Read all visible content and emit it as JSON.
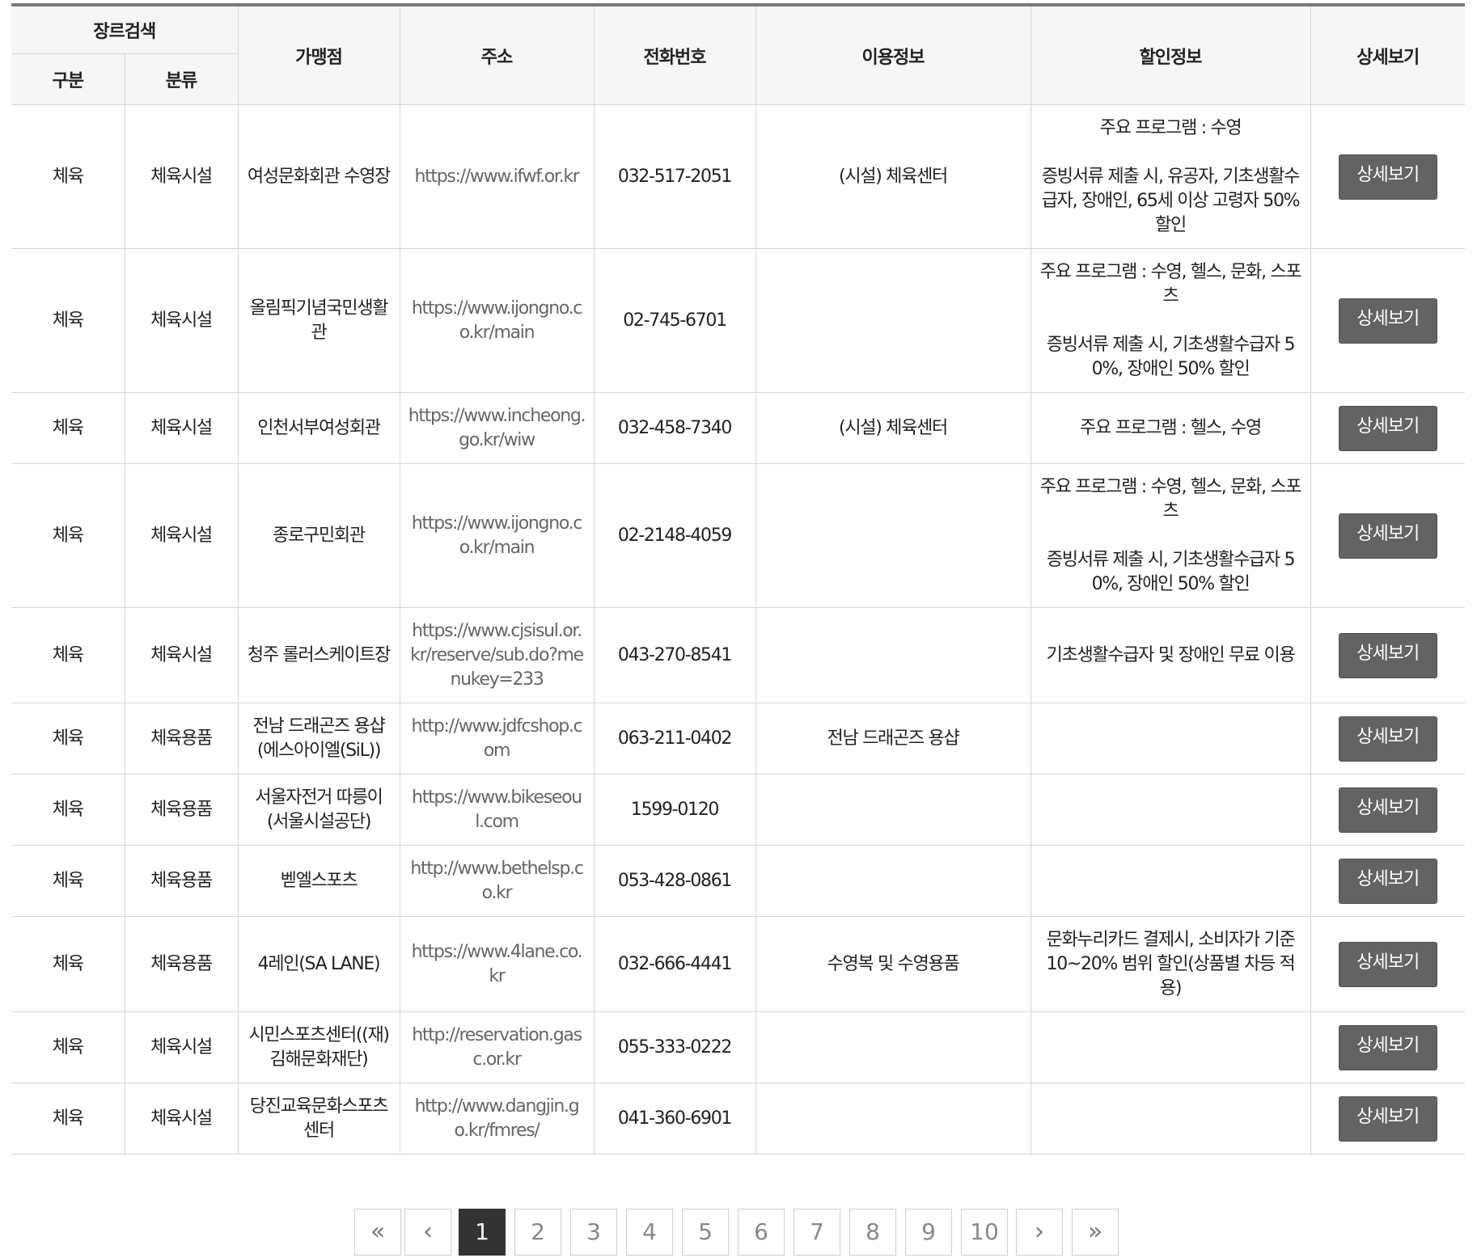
{
  "header": {
    "genre_search": "장르검색",
    "category": "구분",
    "classification": "분류",
    "store": "가맹점",
    "address": "주소",
    "phone": "전화번호",
    "usage_info": "이용정보",
    "discount_info": "할인정보",
    "detail": "상세보기"
  },
  "rows": [
    {
      "category": "체육",
      "classification": "체육시설",
      "store": "여성문화회관 수영장",
      "url": "https://www.ifwf.or.kr",
      "phone": "032-517-2051",
      "usage": "(시설) 체육센터",
      "discount": [
        "주요 프로그램 : 수영",
        "증빙서류 제출 시, 유공자, 기초생활수급자, 장애인, 65세 이상 고령자 50% 할인"
      ],
      "button": "상세보기"
    },
    {
      "category": "체육",
      "classification": "체육시설",
      "store": "올림픽기념국민생활관",
      "url": "https://www.ijongno.co.kr/main",
      "phone": "02-745-6701",
      "usage": "",
      "discount": [
        "주요 프로그램 : 수영, 헬스, 문화, 스포츠",
        "증빙서류 제출 시, 기초생활수급자 50%, 장애인 50% 할인"
      ],
      "button": "상세보기"
    },
    {
      "category": "체육",
      "classification": "체육시설",
      "store": "인천서부여성회관",
      "url": "https://www.incheong.go.kr/wiw",
      "phone": "032-458-7340",
      "usage": "(시설) 체육센터",
      "discount": [
        "주요 프로그램 : 헬스, 수영"
      ],
      "button": "상세보기"
    },
    {
      "category": "체육",
      "classification": "체육시설",
      "store": "종로구민회관",
      "url": "https://www.ijongno.co.kr/main",
      "phone": "02-2148-4059",
      "usage": "",
      "discount": [
        "주요 프로그램 : 수영, 헬스, 문화, 스포츠",
        "증빙서류 제출 시, 기초생활수급자 50%, 장애인 50% 할인"
      ],
      "button": "상세보기"
    },
    {
      "category": "체육",
      "classification": "체육시설",
      "store": "청주 롤러스케이트장",
      "url": "https://www.cjsisul.or.kr/reserve/sub.do?menukey=233",
      "phone": "043-270-8541",
      "usage": "",
      "discount": [
        "기초생활수급자 및 장애인 무료 이용"
      ],
      "button": "상세보기"
    },
    {
      "category": "체육",
      "classification": "체육용품",
      "store": "전남 드래곤즈 용샵(에스아이엘(SiL))",
      "url": "http://www.jdfcshop.com",
      "phone": "063-211-0402",
      "usage": "전남 드래곤즈 용샵",
      "discount": [],
      "button": "상세보기"
    },
    {
      "category": "체육",
      "classification": "체육용품",
      "store": "서울자전거 따릉이(서울시설공단)",
      "url": "https://www.bikeseoul.com",
      "phone": "1599-0120",
      "usage": "",
      "discount": [],
      "button": "상세보기"
    },
    {
      "category": "체육",
      "classification": "체육용품",
      "store": "벧엘스포츠",
      "url": "http://www.bethelsp.co.kr",
      "phone": "053-428-0861",
      "usage": "",
      "discount": [],
      "button": "상세보기"
    },
    {
      "category": "체육",
      "classification": "체육용품",
      "store": "4레인(SA LANE)",
      "url": "https://www.4lane.co.kr",
      "phone": "032-666-4441",
      "usage": "수영복 및 수영용품",
      "discount": [
        "문화누리카드 결제시, 소비자가 기준 10~20% 범위 할인(상품별 차등 적용)"
      ],
      "button": "상세보기"
    },
    {
      "category": "체육",
      "classification": "체육시설",
      "store": "시민스포츠센터((재)김해문화재단)",
      "url": "http://reservation.gasc.or.kr",
      "phone": "055-333-0222",
      "usage": "",
      "discount": [],
      "button": "상세보기"
    },
    {
      "category": "체육",
      "classification": "체육시설",
      "store": "당진교육문화스포츠센터",
      "url": "http://www.dangjin.go.kr/fmres/",
      "phone": "041-360-6901",
      "usage": "",
      "discount": [],
      "button": "상세보기"
    }
  ],
  "pagination": {
    "first": "«",
    "prev": "‹",
    "pages": [
      "1",
      "2",
      "3",
      "4",
      "5",
      "6",
      "7",
      "8",
      "9",
      "10"
    ],
    "current": "1",
    "next": "›",
    "last": "»"
  }
}
